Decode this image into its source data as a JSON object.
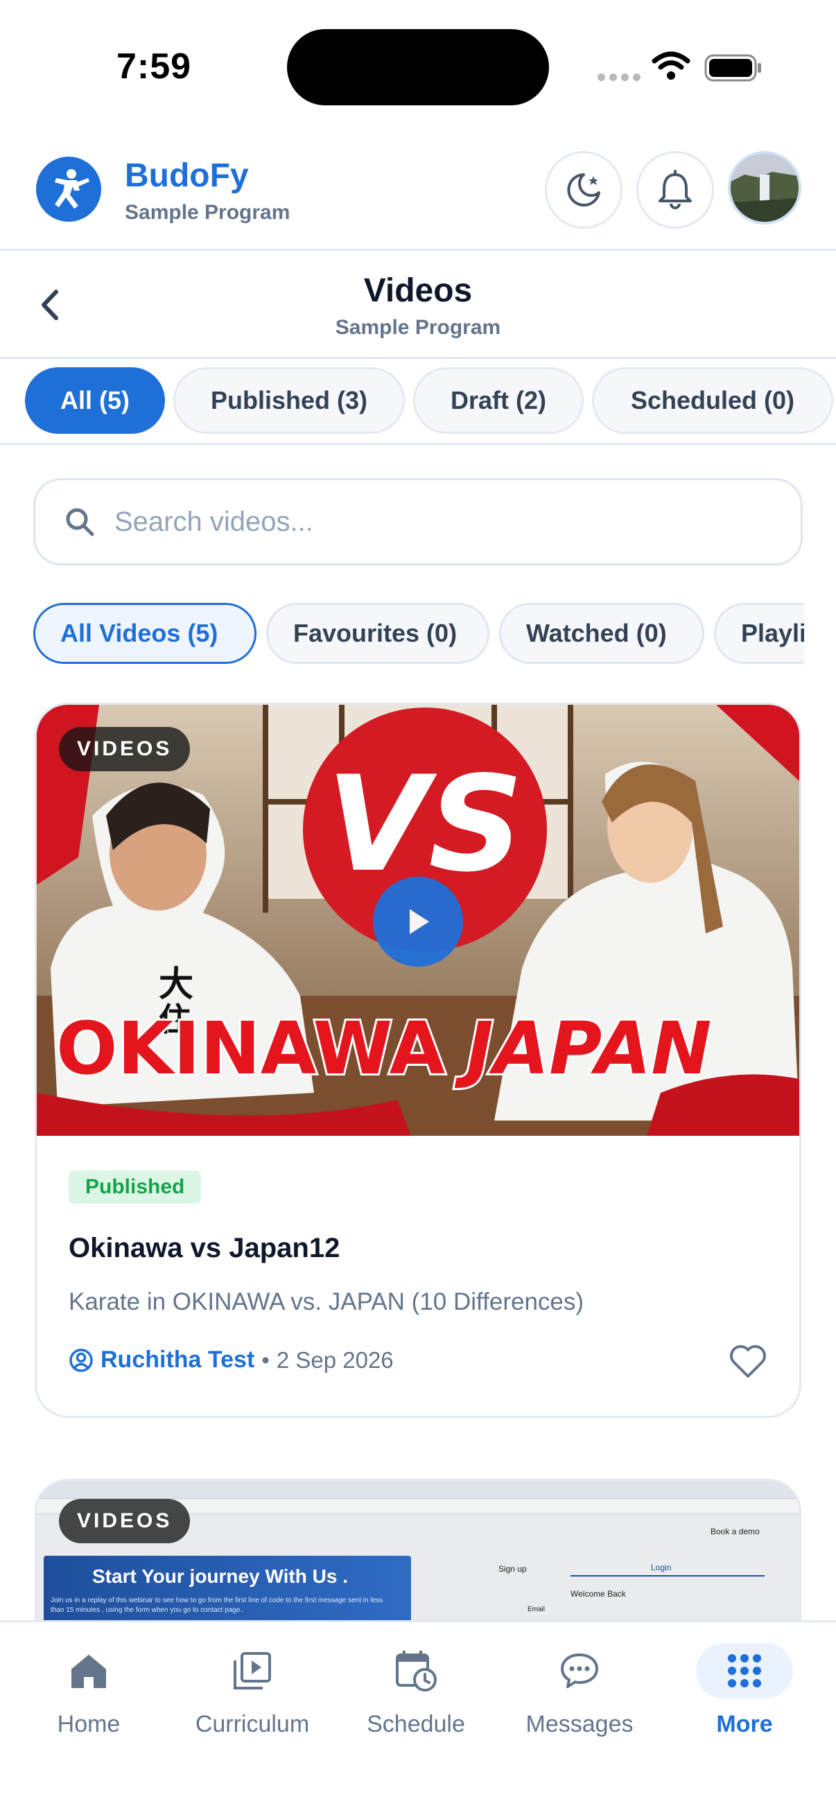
{
  "status_bar": {
    "time": "7:59"
  },
  "header": {
    "brand": "BudoFy",
    "program": "Sample Program",
    "icons": [
      "moon-icon",
      "bell-icon"
    ]
  },
  "page": {
    "title": "Videos",
    "subtitle": "Sample Program"
  },
  "status_tabs": [
    {
      "label": "All (5)",
      "active": true
    },
    {
      "label": "Published (3)",
      "active": false
    },
    {
      "label": "Draft (2)",
      "active": false
    },
    {
      "label": "Scheduled (0)",
      "active": false
    }
  ],
  "search": {
    "placeholder": "Search videos...",
    "value": ""
  },
  "filters": [
    {
      "label": "All Videos (5)",
      "active": true
    },
    {
      "label": "Favourites (0)",
      "active": false
    },
    {
      "label": "Watched (0)",
      "active": false
    },
    {
      "label": "Playli",
      "active": false
    }
  ],
  "videos": [
    {
      "badge": "VIDEOS",
      "thumbnail_text": {
        "vs": "VS",
        "left": "OKINAWA",
        "right": "JAPAN",
        "kanji": "大\n住"
      },
      "status": "Published",
      "title": "Okinawa vs Japan12",
      "description": "Karate in OKINAWA vs. JAPAN (10 Differences)",
      "author": "Ruchitha Test",
      "separator": "•",
      "date": "2 Sep 2026"
    },
    {
      "badge": "VIDEOS",
      "thumbnail_text": {
        "banner_title": "Start Your journey With Us .",
        "banner_text": "Join us in a replay of this webinar to see how to go from the first line of code to the first message sent in less than 15 minutes , using the form when you go to contact page..",
        "signup": "Sign up",
        "login": "Login",
        "welcome": "Welcome Back",
        "email": "Email",
        "book_demo": "Book a demo"
      }
    }
  ],
  "bottom_nav": [
    {
      "label": "Home",
      "icon": "home-icon",
      "active": false
    },
    {
      "label": "Curriculum",
      "icon": "video-library-icon",
      "active": false
    },
    {
      "label": "Schedule",
      "icon": "calendar-clock-icon",
      "active": false
    },
    {
      "label": "Messages",
      "icon": "chat-bubble-icon",
      "active": false
    },
    {
      "label": "More",
      "icon": "grid-dots-icon",
      "active": true
    }
  ],
  "colors": {
    "accent": "#1f6fd8",
    "published_bg": "#dcf6e6",
    "published_text": "#16a34a",
    "muted": "#64748b"
  }
}
